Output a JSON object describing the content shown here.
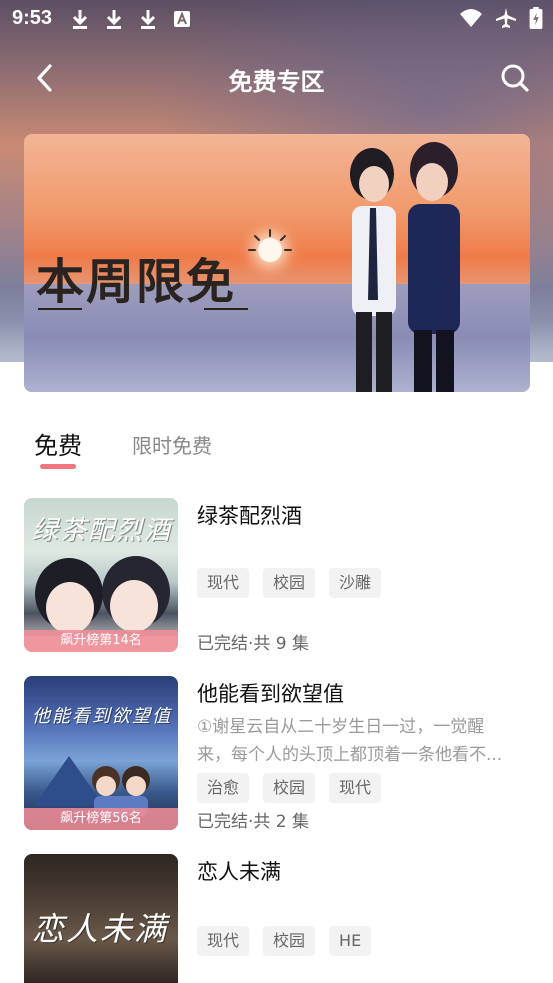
{
  "status_bar": {
    "time": "9:53",
    "left_icons": [
      "download-icon",
      "download-icon",
      "download-icon",
      "font-a-icon"
    ],
    "right_icons": [
      "wifi-icon",
      "airplane-icon",
      "battery-charging-icon"
    ]
  },
  "nav": {
    "title": "免费专区",
    "back_icon": "chevron-left-icon",
    "search_icon": "search-icon"
  },
  "banner": {
    "headline": "本周限免"
  },
  "tabs": [
    {
      "label": "免费",
      "active": true
    },
    {
      "label": "限时免费",
      "active": false
    }
  ],
  "accent_color": "#f0757e",
  "books": [
    {
      "title": "绿茶配烈酒",
      "cover_text": "绿茶配烈酒",
      "rank": "飙升榜第14名",
      "description_lines": [],
      "tags": [
        "现代",
        "校园",
        "沙雕"
      ],
      "status": "已完结·共 9 集"
    },
    {
      "title": "他能看到欲望值",
      "cover_text": "他能看到欲望值",
      "rank": "飙升榜第56名",
      "description_lines": [
        "①谢星云自从二十岁生日一过，一觉醒",
        "来，每个人的头顶上都顶着一条他看不..."
      ],
      "tags": [
        "治愈",
        "校园",
        "现代"
      ],
      "status": "已完结·共 2 集"
    },
    {
      "title": "恋人未满",
      "cover_text": "恋人未满",
      "rank": "",
      "description_lines": [],
      "tags": [
        "现代",
        "校园",
        "HE"
      ],
      "status": ""
    }
  ]
}
